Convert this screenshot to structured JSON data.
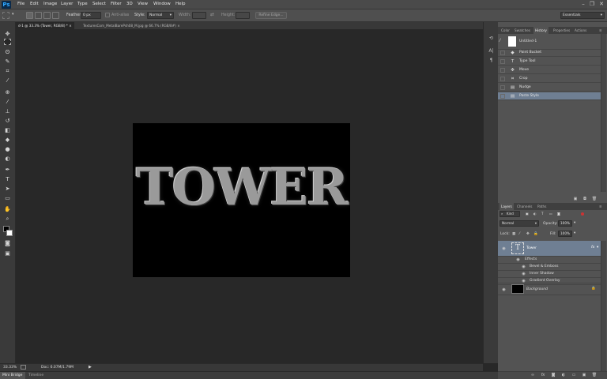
{
  "app": {
    "logo": "Ps"
  },
  "menu": [
    "File",
    "Edit",
    "Image",
    "Layer",
    "Type",
    "Select",
    "Filter",
    "3D",
    "View",
    "Window",
    "Help"
  ],
  "window_controls": {
    "minimize": "–",
    "restore": "❐",
    "close": "✕"
  },
  "options": {
    "feather_label": "Feather:",
    "feather_value": "0 px",
    "anti_alias": "Anti-alias",
    "style_label": "Style:",
    "style_value": "Normal",
    "width_label": "Width:",
    "height_label": "Height:",
    "refine_edge": "Refine Edge...",
    "workspace": "Essentials"
  },
  "doc_tabs": [
    {
      "label": "d-1 @ 33.3% (Tower, RGB/8) *  ×"
    },
    {
      "label": "TexturesCom_MetalBarePsh08_M.jpg @ 66.7% (RGB/8#)  ×"
    }
  ],
  "canvas": {
    "text": "TOWER"
  },
  "status": {
    "zoom": "33.33%",
    "doc": "Doc: 6.07M/1.79M"
  },
  "bottom_tabs": [
    "Mini Bridge",
    "Timeline"
  ],
  "top_panel_tabs": [
    "Color",
    "Swatches",
    "History",
    "Properties",
    "Actions"
  ],
  "history": {
    "snapshot": "Untitled-1",
    "items": [
      "Paint Bucket",
      "Type Tool",
      "Move",
      "Crop",
      "Nudge",
      "Paste Style"
    ]
  },
  "layers_panel": {
    "tabs": [
      "Layers",
      "Channels",
      "Paths"
    ],
    "kind": "Kind",
    "blend_mode": "Normal",
    "opacity_label": "Opacity:",
    "opacity_value": "100%",
    "lock_label": "Lock:",
    "fill_label": "Fill:",
    "fill_value": "100%",
    "layers": [
      {
        "name": "Tower",
        "fx": "fx"
      },
      {
        "name": "Background"
      }
    ],
    "effects_label": "Effects",
    "effects": [
      "Bevel & Emboss",
      "Inner Shadow",
      "Gradient Overlay"
    ]
  },
  "colors": {
    "accent": "#6f7f93",
    "panel": "#535353",
    "chrome": "#3a3a3a",
    "canvas_bg": "#282828"
  }
}
